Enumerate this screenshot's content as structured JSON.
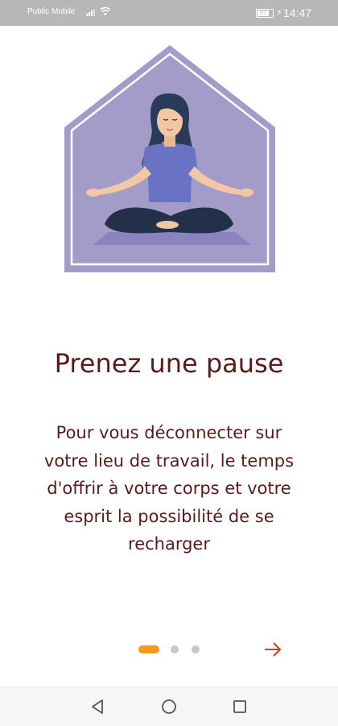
{
  "status_bar": {
    "carrier": "Public Mobile",
    "battery": "87",
    "time": "14:47"
  },
  "onboarding": {
    "title": "Prenez une pause",
    "description": "Pour vous déconnecter sur votre lieu de travail, le temps d'offrir à votre corps et votre esprit la possibilité de se recharger",
    "page_count": 3,
    "current_page": 1
  },
  "icons": {
    "next": "arrow-right-icon",
    "back": "back-triangle-icon",
    "home": "home-circle-icon",
    "recents": "recents-square-icon"
  },
  "colors": {
    "title": "#5b1a1a",
    "accent": "#f39a1c",
    "house": "#a39cc9",
    "next_arrow": "#d63a1a",
    "status_bar": "#b7b7b7"
  }
}
